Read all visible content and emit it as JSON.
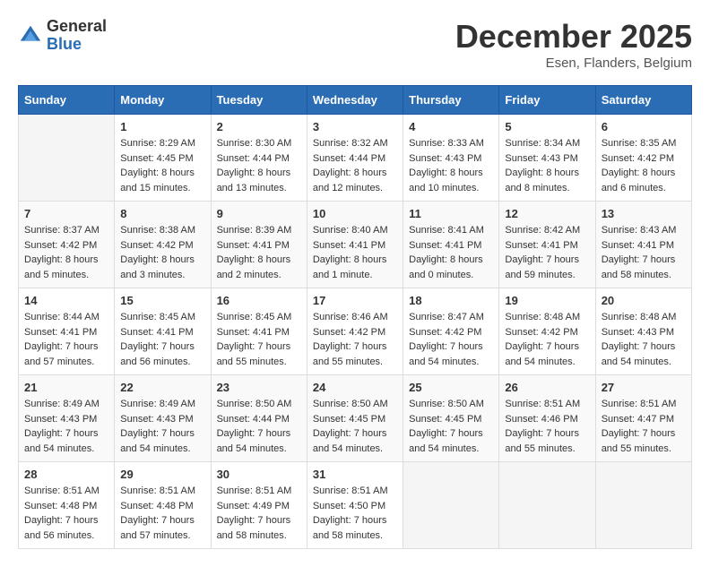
{
  "logo": {
    "general": "General",
    "blue": "Blue"
  },
  "header": {
    "month": "December 2025",
    "location": "Esen, Flanders, Belgium"
  },
  "weekdays": [
    "Sunday",
    "Monday",
    "Tuesday",
    "Wednesday",
    "Thursday",
    "Friday",
    "Saturday"
  ],
  "weeks": [
    [
      {
        "day": "",
        "sunrise": "",
        "sunset": "",
        "daylight": ""
      },
      {
        "day": "1",
        "sunrise": "Sunrise: 8:29 AM",
        "sunset": "Sunset: 4:45 PM",
        "daylight": "Daylight: 8 hours and 15 minutes."
      },
      {
        "day": "2",
        "sunrise": "Sunrise: 8:30 AM",
        "sunset": "Sunset: 4:44 PM",
        "daylight": "Daylight: 8 hours and 13 minutes."
      },
      {
        "day": "3",
        "sunrise": "Sunrise: 8:32 AM",
        "sunset": "Sunset: 4:44 PM",
        "daylight": "Daylight: 8 hours and 12 minutes."
      },
      {
        "day": "4",
        "sunrise": "Sunrise: 8:33 AM",
        "sunset": "Sunset: 4:43 PM",
        "daylight": "Daylight: 8 hours and 10 minutes."
      },
      {
        "day": "5",
        "sunrise": "Sunrise: 8:34 AM",
        "sunset": "Sunset: 4:43 PM",
        "daylight": "Daylight: 8 hours and 8 minutes."
      },
      {
        "day": "6",
        "sunrise": "Sunrise: 8:35 AM",
        "sunset": "Sunset: 4:42 PM",
        "daylight": "Daylight: 8 hours and 6 minutes."
      }
    ],
    [
      {
        "day": "7",
        "sunrise": "Sunrise: 8:37 AM",
        "sunset": "Sunset: 4:42 PM",
        "daylight": "Daylight: 8 hours and 5 minutes."
      },
      {
        "day": "8",
        "sunrise": "Sunrise: 8:38 AM",
        "sunset": "Sunset: 4:42 PM",
        "daylight": "Daylight: 8 hours and 3 minutes."
      },
      {
        "day": "9",
        "sunrise": "Sunrise: 8:39 AM",
        "sunset": "Sunset: 4:41 PM",
        "daylight": "Daylight: 8 hours and 2 minutes."
      },
      {
        "day": "10",
        "sunrise": "Sunrise: 8:40 AM",
        "sunset": "Sunset: 4:41 PM",
        "daylight": "Daylight: 8 hours and 1 minute."
      },
      {
        "day": "11",
        "sunrise": "Sunrise: 8:41 AM",
        "sunset": "Sunset: 4:41 PM",
        "daylight": "Daylight: 8 hours and 0 minutes."
      },
      {
        "day": "12",
        "sunrise": "Sunrise: 8:42 AM",
        "sunset": "Sunset: 4:41 PM",
        "daylight": "Daylight: 7 hours and 59 minutes."
      },
      {
        "day": "13",
        "sunrise": "Sunrise: 8:43 AM",
        "sunset": "Sunset: 4:41 PM",
        "daylight": "Daylight: 7 hours and 58 minutes."
      }
    ],
    [
      {
        "day": "14",
        "sunrise": "Sunrise: 8:44 AM",
        "sunset": "Sunset: 4:41 PM",
        "daylight": "Daylight: 7 hours and 57 minutes."
      },
      {
        "day": "15",
        "sunrise": "Sunrise: 8:45 AM",
        "sunset": "Sunset: 4:41 PM",
        "daylight": "Daylight: 7 hours and 56 minutes."
      },
      {
        "day": "16",
        "sunrise": "Sunrise: 8:45 AM",
        "sunset": "Sunset: 4:41 PM",
        "daylight": "Daylight: 7 hours and 55 minutes."
      },
      {
        "day": "17",
        "sunrise": "Sunrise: 8:46 AM",
        "sunset": "Sunset: 4:42 PM",
        "daylight": "Daylight: 7 hours and 55 minutes."
      },
      {
        "day": "18",
        "sunrise": "Sunrise: 8:47 AM",
        "sunset": "Sunset: 4:42 PM",
        "daylight": "Daylight: 7 hours and 54 minutes."
      },
      {
        "day": "19",
        "sunrise": "Sunrise: 8:48 AM",
        "sunset": "Sunset: 4:42 PM",
        "daylight": "Daylight: 7 hours and 54 minutes."
      },
      {
        "day": "20",
        "sunrise": "Sunrise: 8:48 AM",
        "sunset": "Sunset: 4:43 PM",
        "daylight": "Daylight: 7 hours and 54 minutes."
      }
    ],
    [
      {
        "day": "21",
        "sunrise": "Sunrise: 8:49 AM",
        "sunset": "Sunset: 4:43 PM",
        "daylight": "Daylight: 7 hours and 54 minutes."
      },
      {
        "day": "22",
        "sunrise": "Sunrise: 8:49 AM",
        "sunset": "Sunset: 4:43 PM",
        "daylight": "Daylight: 7 hours and 54 minutes."
      },
      {
        "day": "23",
        "sunrise": "Sunrise: 8:50 AM",
        "sunset": "Sunset: 4:44 PM",
        "daylight": "Daylight: 7 hours and 54 minutes."
      },
      {
        "day": "24",
        "sunrise": "Sunrise: 8:50 AM",
        "sunset": "Sunset: 4:45 PM",
        "daylight": "Daylight: 7 hours and 54 minutes."
      },
      {
        "day": "25",
        "sunrise": "Sunrise: 8:50 AM",
        "sunset": "Sunset: 4:45 PM",
        "daylight": "Daylight: 7 hours and 54 minutes."
      },
      {
        "day": "26",
        "sunrise": "Sunrise: 8:51 AM",
        "sunset": "Sunset: 4:46 PM",
        "daylight": "Daylight: 7 hours and 55 minutes."
      },
      {
        "day": "27",
        "sunrise": "Sunrise: 8:51 AM",
        "sunset": "Sunset: 4:47 PM",
        "daylight": "Daylight: 7 hours and 55 minutes."
      }
    ],
    [
      {
        "day": "28",
        "sunrise": "Sunrise: 8:51 AM",
        "sunset": "Sunset: 4:48 PM",
        "daylight": "Daylight: 7 hours and 56 minutes."
      },
      {
        "day": "29",
        "sunrise": "Sunrise: 8:51 AM",
        "sunset": "Sunset: 4:48 PM",
        "daylight": "Daylight: 7 hours and 57 minutes."
      },
      {
        "day": "30",
        "sunrise": "Sunrise: 8:51 AM",
        "sunset": "Sunset: 4:49 PM",
        "daylight": "Daylight: 7 hours and 58 minutes."
      },
      {
        "day": "31",
        "sunrise": "Sunrise: 8:51 AM",
        "sunset": "Sunset: 4:50 PM",
        "daylight": "Daylight: 7 hours and 58 minutes."
      },
      {
        "day": "",
        "sunrise": "",
        "sunset": "",
        "daylight": ""
      },
      {
        "day": "",
        "sunrise": "",
        "sunset": "",
        "daylight": ""
      },
      {
        "day": "",
        "sunrise": "",
        "sunset": "",
        "daylight": ""
      }
    ]
  ]
}
